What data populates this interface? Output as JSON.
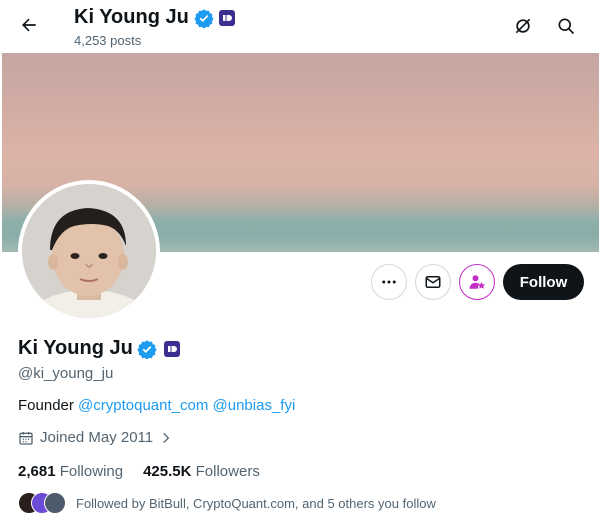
{
  "header": {
    "name": "Ki Young Ju",
    "posts_count": "4,253 posts"
  },
  "profile": {
    "name": "Ki Young Ju",
    "handle": "@ki_young_ju",
    "bio_prefix": "Founder",
    "bio_link_1": "@cryptoquant_com",
    "bio_link_2": "@unbias_fyi",
    "joined": "Joined May 2011",
    "following_count": "2,681",
    "following_label": "Following",
    "followers_count": "425.5K",
    "followers_label": "Followers",
    "followed_by": "Followed by BitBull, CryptoQuant.com, and 5 others you follow"
  },
  "actions": {
    "follow_label": "Follow"
  },
  "colors": {
    "verified_blue": "#1d9bf0",
    "affiliate_badge": "#3b2f8f",
    "follow_bg": "#0f1419",
    "subscribe_accent": "#c22ec6",
    "link": "#1d9bf0"
  },
  "icons": {
    "back": "arrow-left-icon",
    "grok": "grok-icon",
    "search": "search-icon",
    "more": "more-icon",
    "message": "envelope-icon",
    "subscribe": "subscribe-star-icon",
    "calendar": "calendar-icon",
    "verified": "verified-badge-icon"
  }
}
